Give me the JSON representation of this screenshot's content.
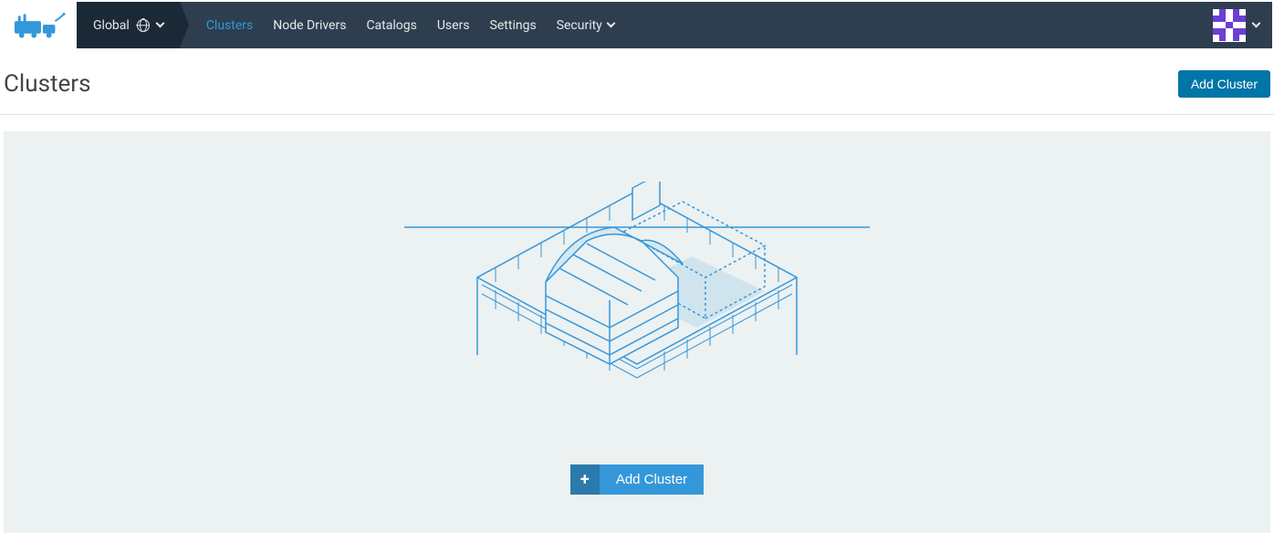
{
  "nav": {
    "global_label": "Global",
    "items": [
      {
        "label": "Clusters",
        "active": true
      },
      {
        "label": "Node Drivers",
        "active": false
      },
      {
        "label": "Catalogs",
        "active": false
      },
      {
        "label": "Users",
        "active": false
      },
      {
        "label": "Settings",
        "active": false
      },
      {
        "label": "Security",
        "active": false,
        "dropdown": true
      }
    ]
  },
  "page": {
    "title": "Clusters",
    "add_button": "Add Cluster"
  },
  "empty": {
    "add_button": "Add Cluster",
    "plus": "+"
  },
  "colors": {
    "nav_bg": "#2e3e4f",
    "nav_dark": "#1b2936",
    "accent": "#3497da",
    "primary_btn": "#0075a8",
    "avatar": "#6b3fd4",
    "panel_bg": "#ecf1f2"
  }
}
